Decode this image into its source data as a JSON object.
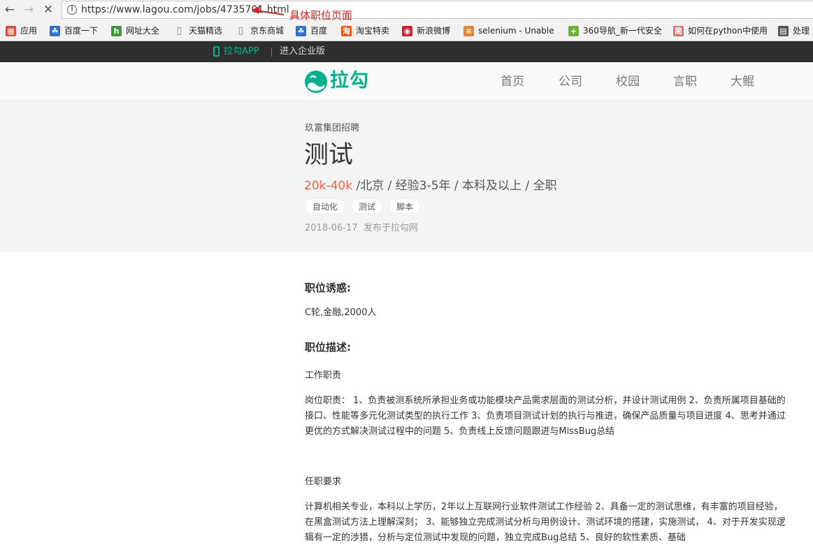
{
  "browser": {
    "url": "https://www.lagou.com/jobs/4735701.html",
    "annotation": "具体职位页面",
    "bookmarks": [
      {
        "label": "应用",
        "icon": "apps-grid-icon",
        "color": "#e04b3c"
      },
      {
        "label": "百度一下",
        "icon": "baidu-paw-icon",
        "color": "#2f6de1"
      },
      {
        "label": "网址大全",
        "icon": "hao123-icon",
        "color": "#3a9e38"
      },
      {
        "label": "天猫精选",
        "icon": "page-icon",
        "color": "#888888"
      },
      {
        "label": "京东商城",
        "icon": "page-icon",
        "color": "#888888"
      },
      {
        "label": "百度",
        "icon": "baidu-paw-icon",
        "color": "#2f6de1"
      },
      {
        "label": "淘宝特卖",
        "icon": "taobao-icon",
        "color": "#ff5000"
      },
      {
        "label": "新浪微博",
        "icon": "weibo-icon",
        "color": "#e6162d"
      },
      {
        "label": "selenium - Unable",
        "icon": "stackoverflow-icon",
        "color": "#f48024"
      },
      {
        "label": "360导航_新一代安全",
        "icon": "360-icon",
        "color": "#6ab42e"
      },
      {
        "label": "如何在python中使用",
        "icon": "jianshu-icon",
        "color": "#ea6f5a"
      },
      {
        "label": "处理",
        "icon": "book-icon",
        "color": "#555555"
      }
    ]
  },
  "topstrip": {
    "app_link": "拉勾APP",
    "business_link": "进入企业版"
  },
  "header": {
    "logo_text": "拉勾",
    "nav": [
      "首页",
      "公司",
      "校园",
      "言职",
      "大鲲"
    ]
  },
  "job": {
    "company_line": "玖富集团招聘",
    "title": "测试",
    "salary": "20k-40k",
    "requirements": " /北京 / 经验3-5年 / 本科及以上 / 全职",
    "tags": [
      "自动化",
      "测试",
      "脚本"
    ],
    "publish_date": "2018-06-17",
    "publish_source": "发布于拉勾网"
  },
  "detail": {
    "advantage_title": "职位诱惑:",
    "advantage_text": "C轮,金融,2000人",
    "description_title": "职位描述:",
    "duties_heading": "工作职责",
    "duties_text": "岗位职责： 1、负责被测系统所承担业务或功能模块产品需求层面的测试分析，并设计测试用例 2、负责所属项目基础的接口、性能等多元化测试类型的执行工作 3、负责项目测试计划的执行与推进，确保产品质量与项目进度 4、思考并通过更优的方式解决测试过程中的问题 5、负责线上反馈问题跟进与MissBug总结",
    "requirements_heading": "任职要求",
    "requirements_text": "计算机相关专业，本科以上学历，2年以上互联网行业软件测试工作经验 2、具备一定的测试思维，有丰富的项目经验，在黑盒测试方法上理解深刻； 3、能够独立完成测试分析与用例设计、测试环境的搭建，实施测试， 4、对于开发实现逻辑有一定的涉猎，分析与定位测试中发现的问题，独立完成Bug总结 5、良好的软性素质、基础"
  },
  "colors": {
    "brand": "#00b38a",
    "salary": "#fd5f39",
    "annotation": "#e02020"
  }
}
